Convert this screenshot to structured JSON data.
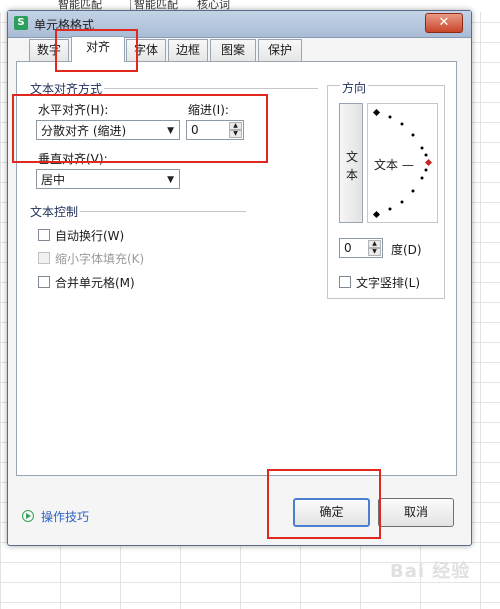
{
  "sheet": {
    "cells_top": [
      "智能匹配",
      "智能匹配",
      "核心词"
    ]
  },
  "dialog": {
    "title": "单元格格式",
    "app_icon": "S",
    "close_symbol": "✕",
    "tabs": [
      "数字",
      "对齐",
      "字体",
      "边框",
      "图案",
      "保护"
    ],
    "active_tab": "对齐"
  },
  "alignment": {
    "group_title": "文本对齐方式",
    "horizontal_label": "水平对齐(H):",
    "horizontal_value": "分散对齐 (缩进)",
    "indent_label": "缩进(I):",
    "indent_value": "0",
    "vertical_label": "垂直对齐(V):",
    "vertical_value": "居中"
  },
  "text_control": {
    "group_title": "文本控制",
    "wrap_text": "自动换行(W)",
    "shrink_to_fit": "缩小字体填充(K)",
    "merge_cells": "合并单元格(M)"
  },
  "orientation": {
    "group_title": "方向",
    "vertical_text_chars": [
      "文",
      "本"
    ],
    "dial_text": "文本 —",
    "degrees_value": "0",
    "degrees_label": "度(D)",
    "stacked_text_label": "文字竖排(L)"
  },
  "footer": {
    "tips_label": "操作技巧",
    "ok_label": "确定",
    "cancel_label": "取消"
  },
  "watermark": "Bai 经验",
  "colors": {
    "highlight": "#e0281e",
    "tips_link": "#2b62c4",
    "primary_border": "#4c7fcf"
  }
}
